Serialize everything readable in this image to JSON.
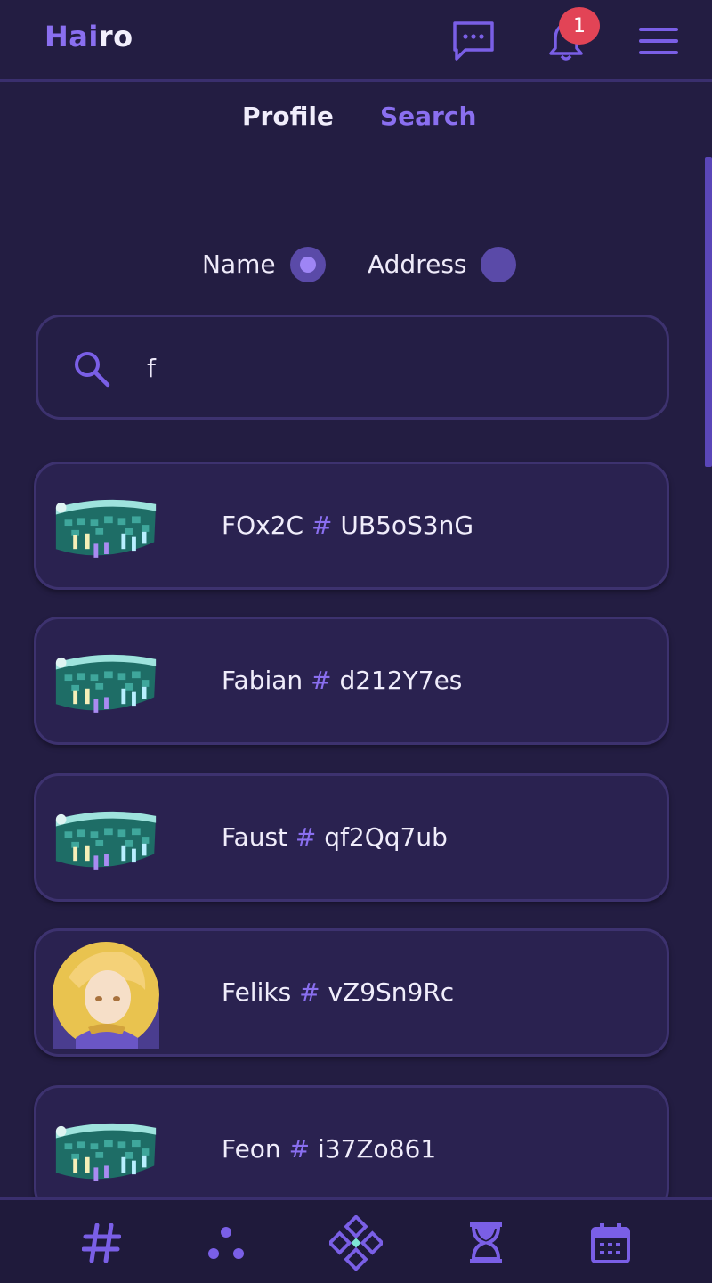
{
  "header": {
    "logo_part1": "Hai",
    "logo_part2": "ro",
    "icons": [
      "chat-icon",
      "bell-icon",
      "menu-icon"
    ],
    "notification_count": "1"
  },
  "tabs": [
    {
      "label": "Profile",
      "active": false
    },
    {
      "label": "Search",
      "active": true
    }
  ],
  "search_mode": {
    "options": [
      {
        "label": "Name",
        "selected": true
      },
      {
        "label": "Address",
        "selected": false
      }
    ]
  },
  "search": {
    "value": "f",
    "placeholder": ""
  },
  "results": [
    {
      "name": "FOx2C",
      "separator": "#",
      "tag": "UB5oS3nG",
      "avatar": "banner-image"
    },
    {
      "name": "Fabian",
      "separator": "#",
      "tag": "d212Y7es",
      "avatar": "banner-image"
    },
    {
      "name": "Faust",
      "separator": "#",
      "tag": "qf2Qq7ub",
      "avatar": "banner-image"
    },
    {
      "name": "Feliks",
      "separator": "#",
      "tag": "vZ9Sn9Rc",
      "avatar": "portrait-image"
    },
    {
      "name": "Feon",
      "separator": "#",
      "tag": "i37Zo861",
      "avatar": "banner-image"
    }
  ],
  "bottom_nav": {
    "items": [
      "hash-icon",
      "dots-icon",
      "diamond-grid-icon",
      "hourglass-icon",
      "calendar-icon"
    ]
  },
  "colors": {
    "background": "#231d42",
    "accent": "#8a6ff0",
    "card": "#2a2250",
    "badge": "#e24456"
  }
}
